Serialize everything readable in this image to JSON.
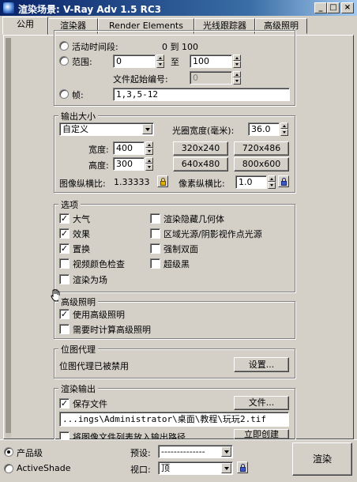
{
  "window": {
    "title": "渲染场景: V-Ray Adv 1.5 RC3"
  },
  "tabs": [
    "公用",
    "渲染器",
    "Render Elements",
    "光线跟踪器",
    "高级照明"
  ],
  "time_output": {
    "range_label": "活动时间段:",
    "range_value": "0 到 100",
    "range2_label": "范围:",
    "range_start": "0",
    "to_label": "至",
    "range_end": "100",
    "file_number_label": "文件起始编号:",
    "file_number": "0",
    "frames_label": "帧:",
    "frames_value": "1,3,5-12"
  },
  "output_size": {
    "title": "输出大小",
    "preset": "自定义",
    "aperture_label": "光圈宽度(毫米):",
    "aperture_value": "36.0",
    "width_label": "宽度:",
    "width_value": "400",
    "height_label": "高度:",
    "height_value": "300",
    "presets": [
      "320x240",
      "720x486",
      "640x480",
      "800x600"
    ],
    "image_aspect_label": "图像纵横比:",
    "image_aspect_value": "1.33333",
    "pixel_aspect_label": "像素纵横比:",
    "pixel_aspect_value": "1.0"
  },
  "options": {
    "title": "选项",
    "items": [
      {
        "label": "大气",
        "checked": true
      },
      {
        "label": "渲染隐藏几何体",
        "checked": false
      },
      {
        "label": "效果",
        "checked": true
      },
      {
        "label": "区域光源/阴影视作点光源",
        "checked": false
      },
      {
        "label": "置换",
        "checked": true
      },
      {
        "label": "强制双面",
        "checked": false
      },
      {
        "label": "视频颜色检查",
        "checked": false
      },
      {
        "label": "超级黑",
        "checked": false
      },
      {
        "label": "渲染为场",
        "checked": false
      }
    ]
  },
  "advanced_lighting": {
    "title": "高级照明",
    "use_label": "使用高级照明",
    "use_checked": true,
    "compute_label": "需要时计算高级照明",
    "compute_checked": false
  },
  "bitmap_proxy": {
    "title": "位图代理",
    "status": "位图代理已被禁用",
    "settings_button": "设置..."
  },
  "render_output": {
    "title": "渲染输出",
    "save_label": "保存文件",
    "save_checked": true,
    "files_button": "文件...",
    "path": "...ings\\Administrator\\桌面\\教程\\玩玩2.tif",
    "put_label": "将图像文件列表放入输出路径",
    "create_button": "立即创建"
  },
  "bottom": {
    "mode_production": "产品级",
    "mode_activeshade": "ActiveShade",
    "preset_label": "预设:",
    "preset_value": "--------------",
    "viewport_label": "视口:",
    "viewport_value": "顶",
    "render_button": "渲染"
  }
}
